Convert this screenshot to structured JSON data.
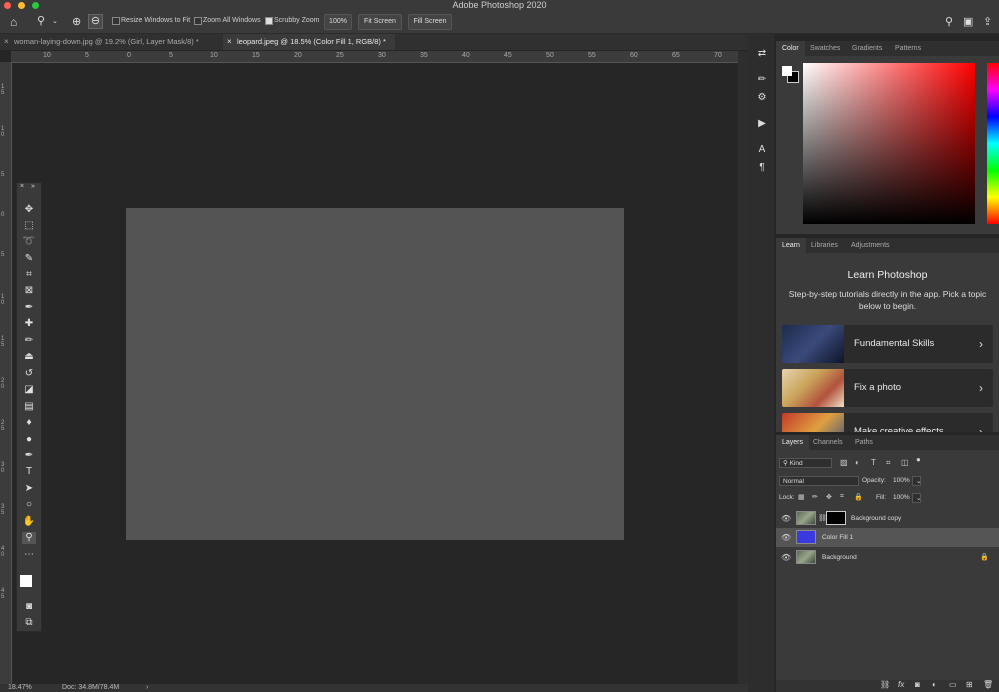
{
  "app": {
    "title": "Adobe Photoshop 2020"
  },
  "colors": {
    "accent_fill": "#3a3adf",
    "canvas_bg": "#262626",
    "doc_bg": "#545454"
  },
  "options": {
    "resize_windows_label": "Resize Windows to Fit",
    "resize_windows_checked": false,
    "zoom_all_label": "Zoom All Windows",
    "zoom_all_checked": false,
    "scrubby_zoom_label": "Scrubby Zoom",
    "scrubby_zoom_checked": true,
    "zoom_value": "100%",
    "fit_screen": "Fit Screen",
    "fill_screen": "Fill Screen"
  },
  "tabs": [
    {
      "label": "woman-laying-down.jpg @ 19.2% (Girl, Layer Mask/8) *",
      "active": false
    },
    {
      "label": "leopard.jpeg @ 18.5% (Color Fill 1, RGB/8) *",
      "active": true
    }
  ],
  "ruler": {
    "h_ticks": [
      "10",
      "5",
      "0",
      "5",
      "10",
      "15",
      "20",
      "25",
      "30",
      "35",
      "40",
      "45",
      "50",
      "55",
      "60",
      "65",
      "70"
    ],
    "v_ticks": [
      "1 5",
      "1 0",
      "5",
      "0",
      "5",
      "1 0",
      "1 5",
      "2 0",
      "2 5",
      "3 0",
      "3 5",
      "4 0",
      "4 5"
    ]
  },
  "status": {
    "zoom": "18.47%",
    "doc": "Doc: 34.8M/78.4M",
    "arrow": "›"
  },
  "color_panel": {
    "tabs": [
      "Color",
      "Swatches",
      "Gradients",
      "Patterns"
    ]
  },
  "learn_panel": {
    "tabs": [
      "Learn",
      "Libraries",
      "Adjustments"
    ],
    "heading": "Learn Photoshop",
    "description": "Step-by-step tutorials directly in the app. Pick a topic below to begin.",
    "cards": [
      "Fundamental Skills",
      "Fix a photo",
      "Make creative effects"
    ]
  },
  "layers_panel": {
    "tabs": [
      "Layers",
      "Channels",
      "Paths"
    ],
    "kind": "Kind",
    "blend_mode": "Normal",
    "opacity_label": "Opacity:",
    "opacity_value": "100%",
    "lock_label": "Lock:",
    "fill_label": "Fill:",
    "fill_value": "100%",
    "layers": [
      {
        "name": "Background copy",
        "selected": false
      },
      {
        "name": "Color Fill 1",
        "selected": true
      },
      {
        "name": "Background",
        "selected": false
      }
    ],
    "footer_icons": [
      "link-icon",
      "fx-icon",
      "mask-icon",
      "adjustment-icon",
      "group-icon",
      "new-layer-icon",
      "trash-icon"
    ]
  }
}
